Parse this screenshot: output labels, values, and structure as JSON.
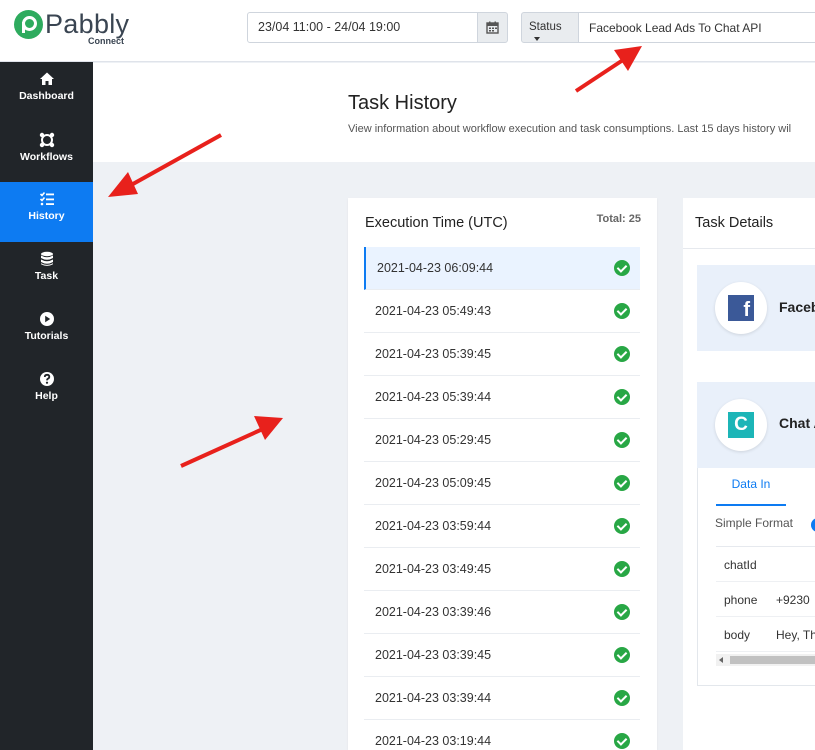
{
  "brand": {
    "name": "Pabbly",
    "sub": "Connect"
  },
  "header": {
    "date_range": "23/04 11:00 - 24/04 19:00",
    "status_label": "Status",
    "workflow_name": "Facebook Lead Ads To Chat API"
  },
  "sidebar": {
    "items": [
      {
        "label": "Dashboard",
        "icon": "home-icon",
        "active": false
      },
      {
        "label": "Workflows",
        "icon": "workflow-icon",
        "active": false
      },
      {
        "label": "History",
        "icon": "history-list-icon",
        "active": true
      },
      {
        "label": "Task",
        "icon": "database-icon",
        "active": false
      },
      {
        "label": "Tutorials",
        "icon": "play-circle-icon",
        "active": false
      },
      {
        "label": "Help",
        "icon": "question-circle-icon",
        "active": false
      }
    ]
  },
  "page": {
    "title": "Task History",
    "subtitle": "View information about workflow execution and task consumptions. Last 15 days history wil"
  },
  "execution": {
    "title": "Execution Time (UTC)",
    "total": "Total: 25",
    "rows": [
      "2021-04-23 06:09:44",
      "2021-04-23 05:49:43",
      "2021-04-23 05:39:45",
      "2021-04-23 05:39:44",
      "2021-04-23 05:29:45",
      "2021-04-23 05:09:45",
      "2021-04-23 03:59:44",
      "2021-04-23 03:49:45",
      "2021-04-23 03:39:46",
      "2021-04-23 03:39:45",
      "2021-04-23 03:39:44",
      "2021-04-23 03:19:44"
    ]
  },
  "details": {
    "title": "Task Details",
    "apps": [
      {
        "name": "Faceb",
        "logo": "f",
        "icon": "facebook-icon"
      },
      {
        "name": "Chat A",
        "logo": "C",
        "icon": "chat-api-icon"
      }
    ],
    "tab": "Data In",
    "simple_format": "Simple Format",
    "fields": [
      {
        "key": "chatId",
        "value": ""
      },
      {
        "key": "phone",
        "value": "+9230"
      },
      {
        "key": "body",
        "value": "Hey, Th"
      }
    ]
  },
  "colors": {
    "accent": "#0d7bf2",
    "sidebar": "#212529",
    "success": "#28a745",
    "annotation_arrow": "#e8211c"
  }
}
